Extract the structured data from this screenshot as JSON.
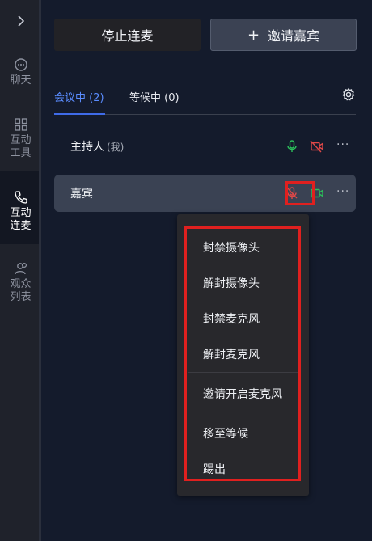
{
  "rail": {
    "toggle": ">",
    "items": [
      {
        "label_line1": "聊天",
        "label_line2": ""
      },
      {
        "label_line1": "互动",
        "label_line2": "工具"
      },
      {
        "label_line1": "互动",
        "label_line2": "连麦"
      },
      {
        "label_line1": "观众",
        "label_line2": "列表"
      }
    ]
  },
  "actions": {
    "stop_label": "停止连麦",
    "invite_label": "邀请嘉宾",
    "invite_icon": "+"
  },
  "tabs": [
    {
      "label": "会议中 (2)"
    },
    {
      "label": "等候中 (0)"
    }
  ],
  "participants": [
    {
      "name": "主持人",
      "tag": "(我)",
      "mic": "on",
      "camera": "off",
      "more": "···"
    },
    {
      "name": "嘉宾",
      "tag": "",
      "mic": "off",
      "camera": "on",
      "more": "···"
    }
  ],
  "menu": {
    "items": [
      "封禁摄像头",
      "解封摄像头",
      "封禁麦克风",
      "解封麦克风",
      "邀请开启麦克风",
      "移至等候",
      "踢出"
    ]
  },
  "colors": {
    "accent": "#5a8cff",
    "mic_on": "#2bbf5a",
    "mic_off": "#e04848",
    "highlight": "#e0201f"
  }
}
